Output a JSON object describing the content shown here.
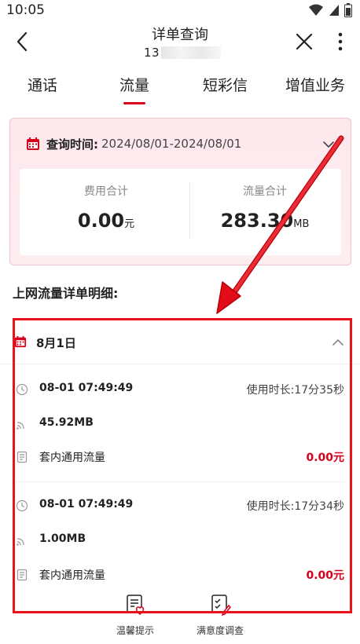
{
  "status_bar": {
    "time": "10:05"
  },
  "header": {
    "title": "详单查询",
    "phone_prefix": "13"
  },
  "tabs": [
    {
      "label": "通话",
      "active": false
    },
    {
      "label": "流量",
      "active": true
    },
    {
      "label": "短彩信",
      "active": false
    },
    {
      "label": "增值业务",
      "active": false
    }
  ],
  "query": {
    "label": "查询时间:",
    "value": "2024/08/01-2024/08/01"
  },
  "summary": {
    "fee_caption": "费用合计",
    "fee_value": "0.00",
    "fee_unit": "元",
    "traffic_caption": "流量合计",
    "traffic_value": "283.30",
    "traffic_unit": "MB"
  },
  "section_title": "上网流量详单明细:",
  "day": {
    "title": "8月1日"
  },
  "records": [
    {
      "time": "08-01 07:49:49",
      "duration_label": "使用时长:",
      "duration": "17分35秒",
      "usage": "45.92MB",
      "type": "套内通用流量",
      "amount": "0.00元"
    },
    {
      "time": "08-01 07:49:49",
      "duration_label": "使用时长:",
      "duration": "17分34秒",
      "usage": "1.00MB",
      "type": "套内通用流量",
      "amount": "0.00元"
    }
  ],
  "bottom_actions": [
    {
      "label": "温馨提示",
      "icon": "notice-heart-icon"
    },
    {
      "label": "满意度调查",
      "icon": "survey-icon"
    }
  ],
  "colors": {
    "accent": "#d9001b",
    "annotation": "#e8111c",
    "card_bg": "#fde8ec"
  }
}
